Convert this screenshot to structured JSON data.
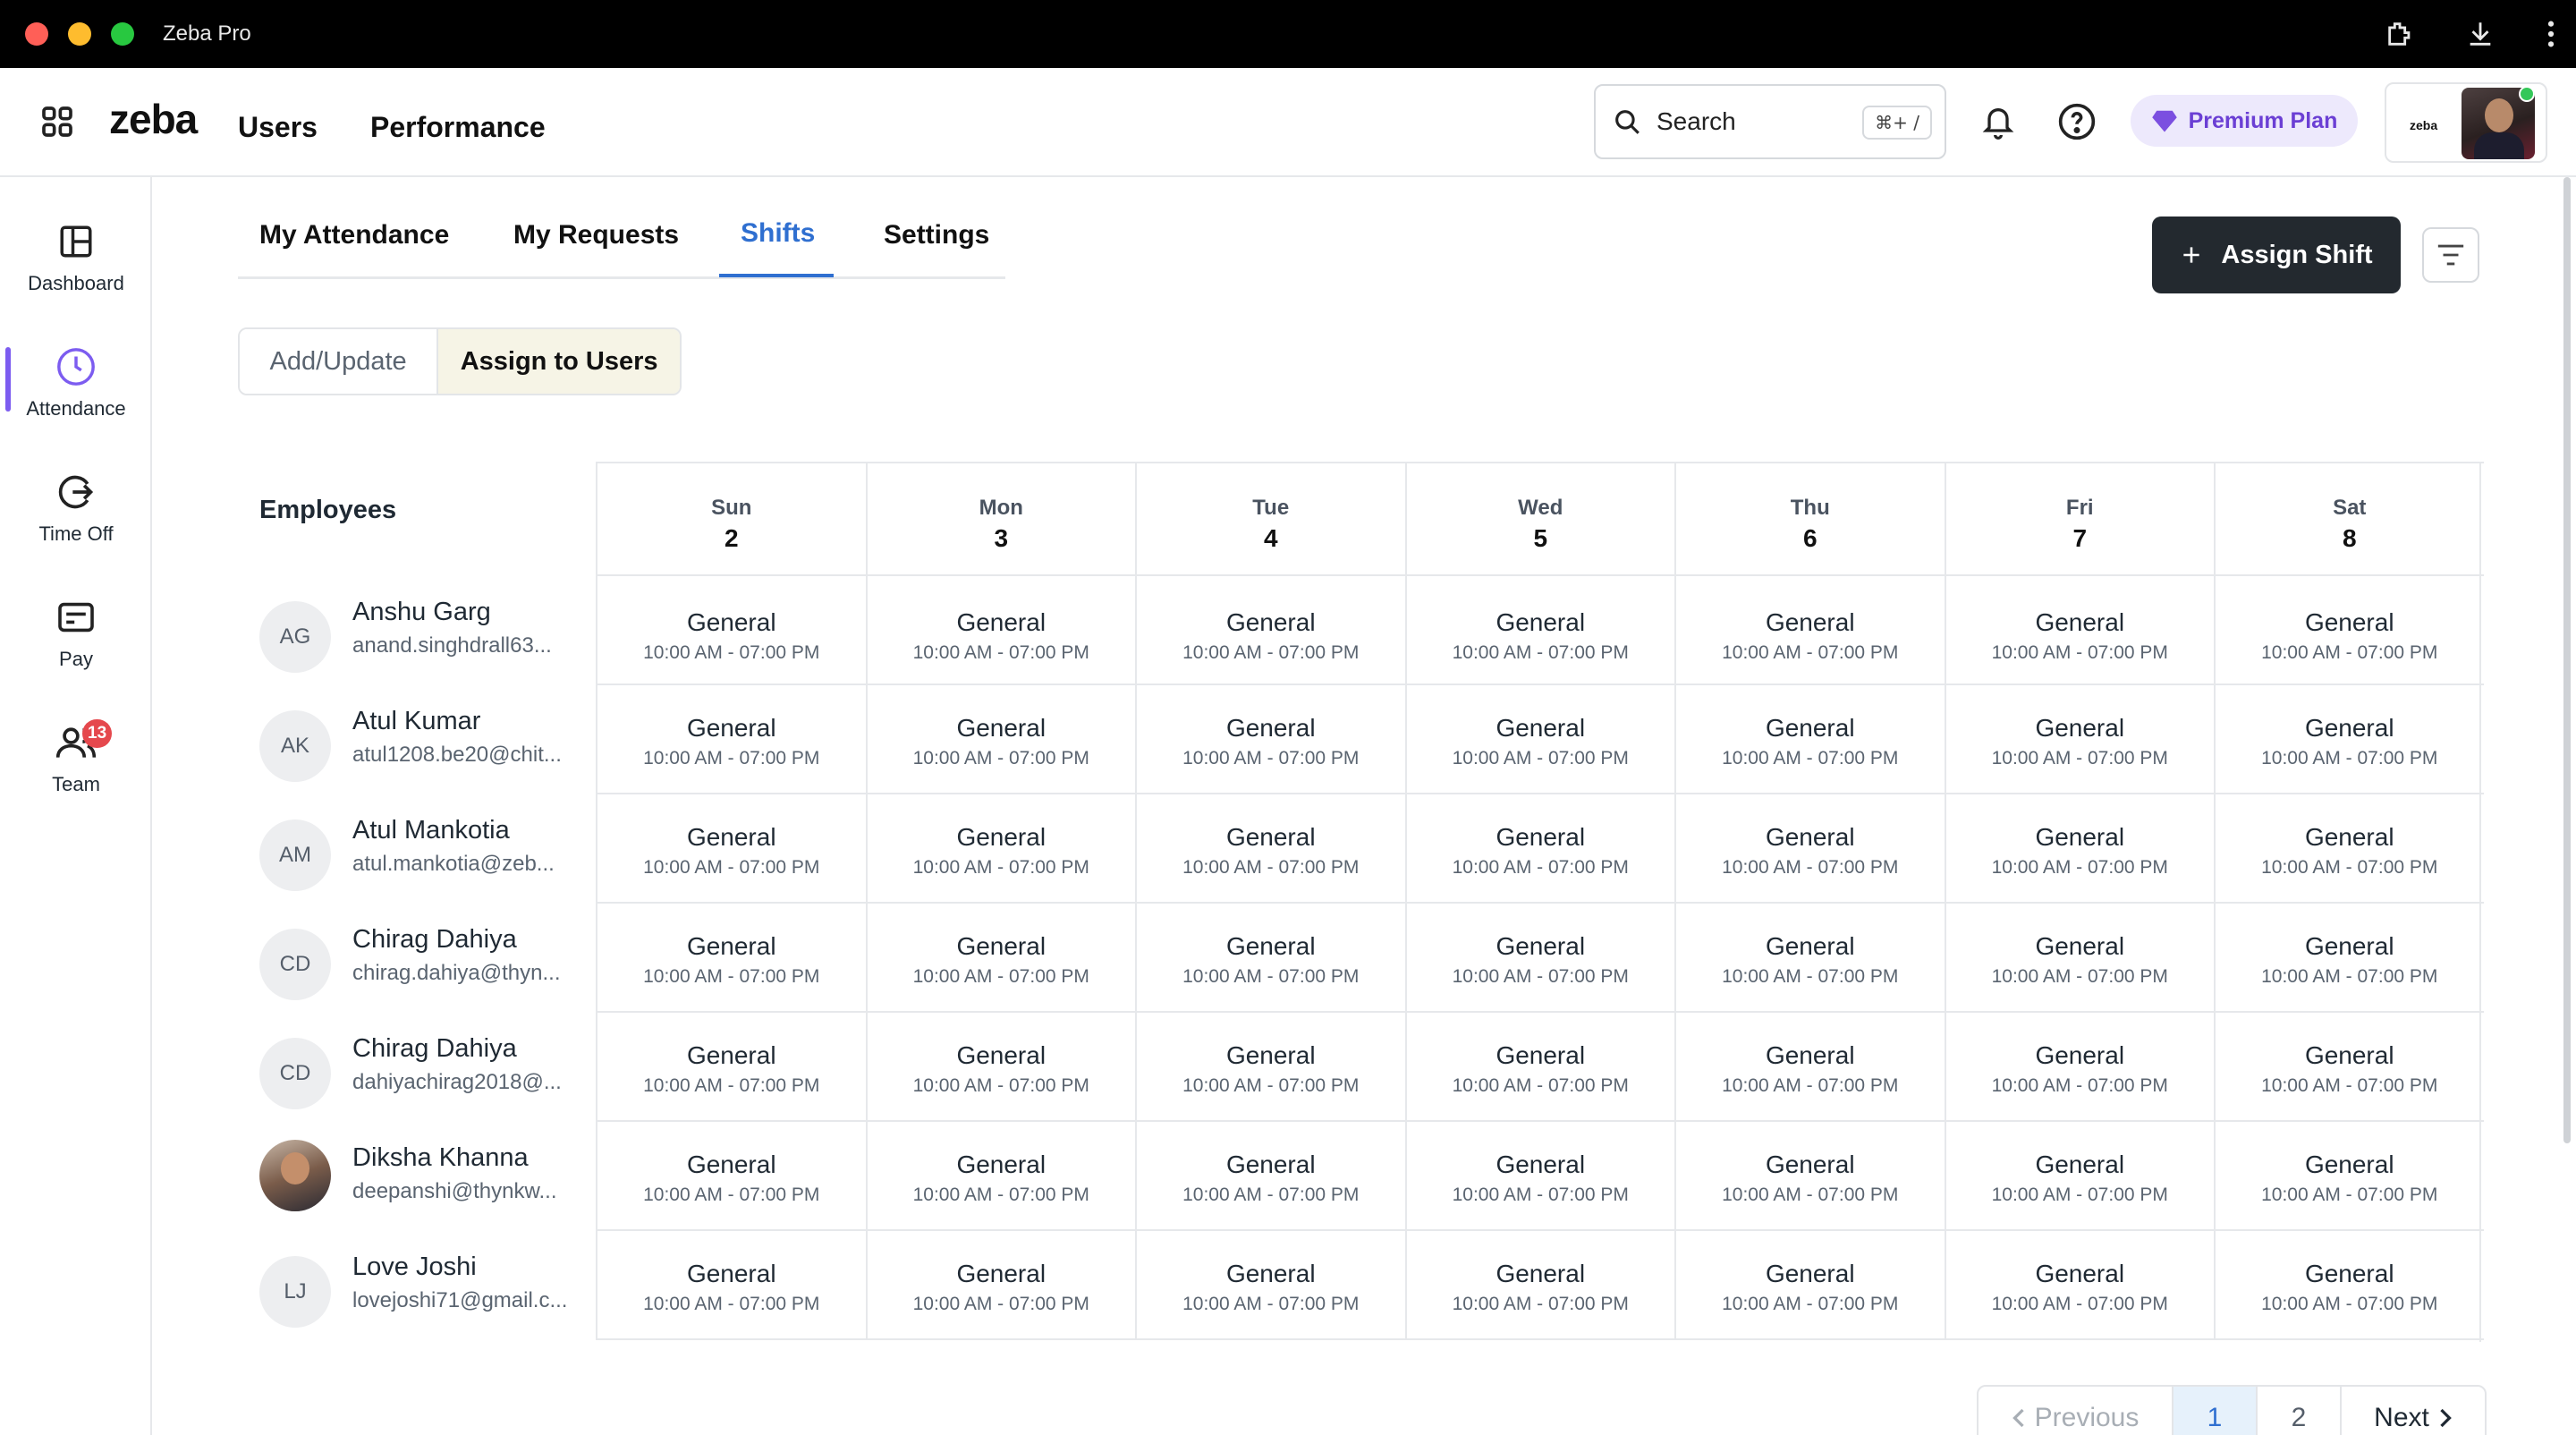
{
  "window": {
    "title": "Zeba Pro"
  },
  "header": {
    "logo": "zeba",
    "nav": [
      "Users",
      "Performance"
    ],
    "search_placeholder": "Search",
    "search_shortcut": "⌘+ /",
    "premium_label": "Premium Plan",
    "profile_logo": "zeba"
  },
  "sidebar": {
    "items": [
      {
        "label": "Dashboard",
        "icon": "dashboard-icon"
      },
      {
        "label": "Attendance",
        "icon": "clock-icon",
        "active": true
      },
      {
        "label": "Time Off",
        "icon": "time-off-icon"
      },
      {
        "label": "Pay",
        "icon": "wallet-icon"
      },
      {
        "label": "Team",
        "icon": "team-icon",
        "badge": "13"
      }
    ]
  },
  "tabs": [
    "My Attendance",
    "My Requests",
    "Shifts",
    "Settings"
  ],
  "active_tab": "Shifts",
  "actions": {
    "assign_shift": "Assign Shift"
  },
  "segment": {
    "options": [
      "Add/Update",
      "Assign to Users"
    ],
    "selected": "Assign to Users"
  },
  "table": {
    "employees_header": "Employees",
    "days": [
      {
        "name": "Sun",
        "num": "2"
      },
      {
        "name": "Mon",
        "num": "3"
      },
      {
        "name": "Tue",
        "num": "4"
      },
      {
        "name": "Wed",
        "num": "5"
      },
      {
        "name": "Thu",
        "num": "6"
      },
      {
        "name": "Fri",
        "num": "7"
      },
      {
        "name": "Sat",
        "num": "8"
      }
    ],
    "rows": [
      {
        "initials": "AG",
        "name": "Anshu Garg",
        "email": "anand.singhdrall63...",
        "shift": "General",
        "time": "10:00 AM - 07:00 PM"
      },
      {
        "initials": "AK",
        "name": "Atul Kumar",
        "email": "atul1208.be20@chit...",
        "shift": "General",
        "time": "10:00 AM - 07:00 PM"
      },
      {
        "initials": "AM",
        "name": "Atul Mankotia",
        "email": "atul.mankotia@zeb...",
        "shift": "General",
        "time": "10:00 AM - 07:00 PM"
      },
      {
        "initials": "CD",
        "name": "Chirag Dahiya",
        "email": "chirag.dahiya@thyn...",
        "shift": "General",
        "time": "10:00 AM - 07:00 PM"
      },
      {
        "initials": "CD",
        "name": "Chirag Dahiya",
        "email": "dahiyachirag2018@...",
        "shift": "General",
        "time": "10:00 AM - 07:00 PM"
      },
      {
        "initials": "",
        "photo": true,
        "name": "Diksha Khanna",
        "email": "deepanshi@thynkw...",
        "shift": "General",
        "time": "10:00 AM - 07:00 PM"
      },
      {
        "initials": "LJ",
        "name": "Love Joshi",
        "email": "lovejoshi71@gmail.c...",
        "shift": "General",
        "time": "10:00 AM - 07:00 PM"
      }
    ]
  },
  "pagination": {
    "previous": "Previous",
    "pages": [
      "1",
      "2"
    ],
    "current": "1",
    "next": "Next"
  },
  "colors": {
    "accent": "#2f6fd0",
    "premium": "#6b3fd4",
    "sidebar_active": "#7c5cf0",
    "badge": "#e5484d"
  }
}
